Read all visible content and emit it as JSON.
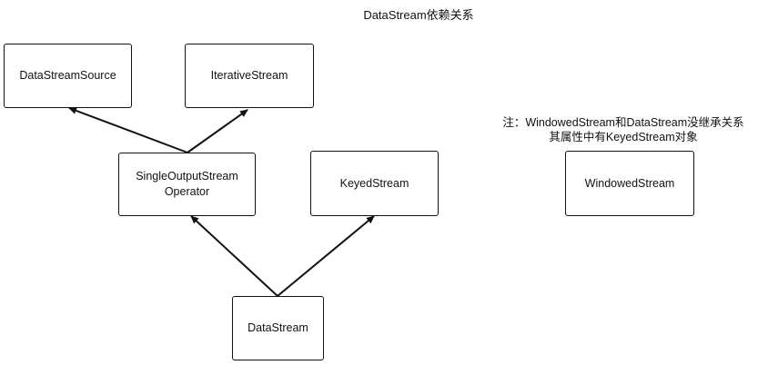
{
  "title": "DataStream依赖关系",
  "note": {
    "line1": "注：WindowedStream和DataStream没继承关系",
    "line2": "其属性中有KeyedStream对象"
  },
  "nodes": {
    "datastream_source": "DataStreamSource",
    "iterative_stream": "IterativeStream",
    "single_output_stream_operator_line1": "SingleOutputStream",
    "single_output_stream_operator_line2": "Operator",
    "keyed_stream": "KeyedStream",
    "windowed_stream": "WindowedStream",
    "datastream": "DataStream"
  }
}
